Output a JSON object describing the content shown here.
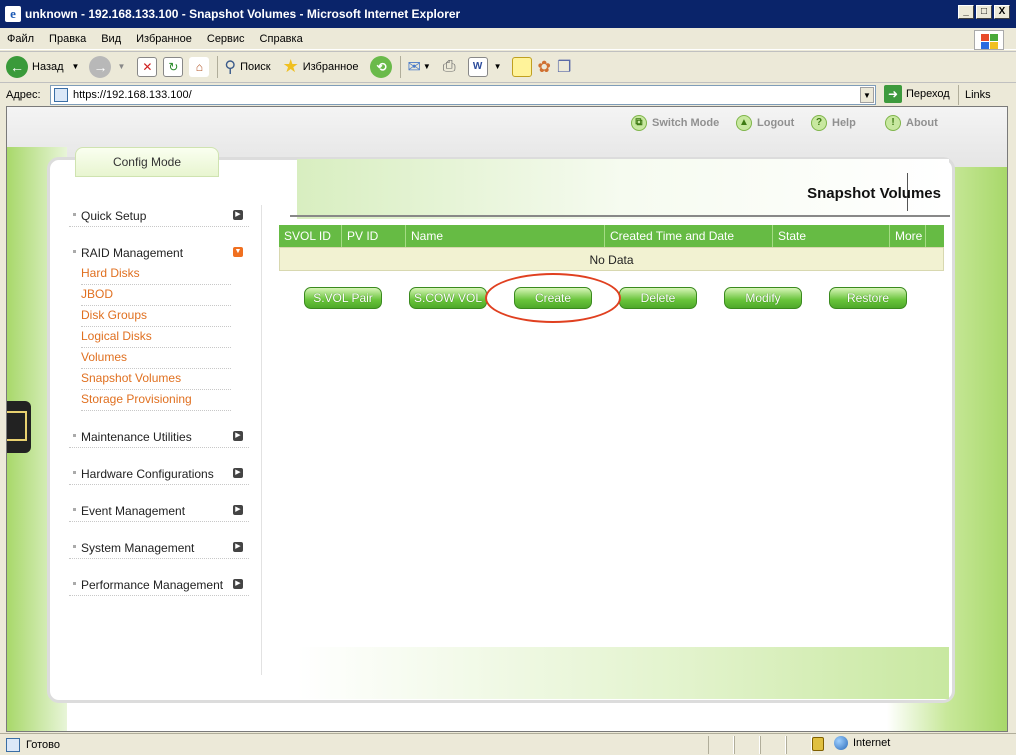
{
  "window": {
    "title": "unknown - 192.168.133.100 - Snapshot Volumes - Microsoft Internet Explorer",
    "minimize": "_",
    "maximize": "□",
    "close": "X"
  },
  "menubar": [
    "Файл",
    "Правка",
    "Вид",
    "Избранное",
    "Сервис",
    "Справка"
  ],
  "toolbar": {
    "back_label": "Назад",
    "search_label": "Поиск",
    "favorites_label": "Избранное"
  },
  "addressbar": {
    "label": "Адрес:",
    "url": "https://192.168.133.100/",
    "go_label": "Переход",
    "links_label": "Links"
  },
  "toplinks": {
    "switch_mode": "Switch Mode",
    "logout": "Logout",
    "help": "Help",
    "about": "About"
  },
  "mode_tab": "Config Mode",
  "sidebar": {
    "items": [
      {
        "label": "Quick Setup"
      },
      {
        "label": "RAID Management"
      },
      {
        "label": "Maintenance Utilities"
      },
      {
        "label": "Hardware Configurations"
      },
      {
        "label": "Event Management"
      },
      {
        "label": "System Management"
      },
      {
        "label": "Performance Management"
      }
    ],
    "raid_sub": [
      "Hard Disks",
      "JBOD",
      "Disk Groups",
      "Logical Disks",
      "Volumes",
      "Snapshot Volumes",
      "Storage Provisioning"
    ]
  },
  "page_title": "Snapshot Volumes",
  "table": {
    "columns": [
      "SVOL ID",
      "PV ID",
      "Name",
      "Created Time and Date",
      "State",
      "More"
    ],
    "empty_text": "No Data"
  },
  "buttons": {
    "svol_pair": "S.VOL Pair",
    "scow_vol": "S.COW VOL",
    "create": "Create",
    "delete": "Delete",
    "modify": "Modify",
    "restore": "Restore"
  },
  "statusbar": {
    "status": "Готово",
    "zone": "Internet"
  },
  "colors": {
    "accent_green": "#66bb44",
    "link_orange": "#e07020",
    "highlight_ring": "#e04020"
  }
}
